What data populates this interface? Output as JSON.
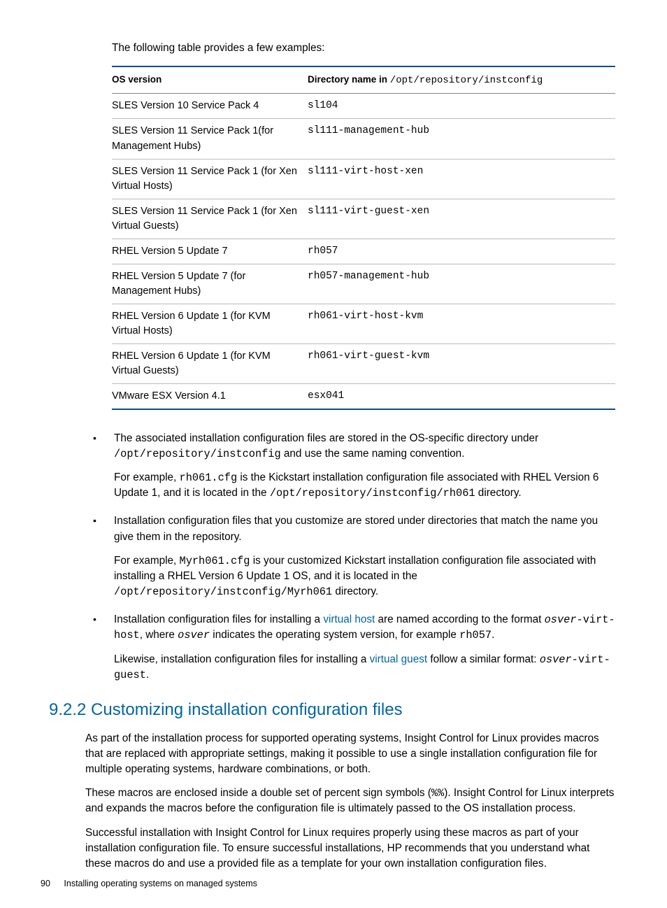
{
  "intro": "The following table provides a few examples:",
  "table": {
    "headers": {
      "os": "OS version",
      "dir_prefix": "Directory name in ",
      "dir_path": "/opt/repository/instconfig"
    },
    "rows": [
      {
        "os": "SLES Version 10 Service Pack 4",
        "dir": "sl104"
      },
      {
        "os": "SLES Version 11 Service Pack 1(for Management Hubs)",
        "dir": "sl111-management-hub"
      },
      {
        "os": "SLES Version 11 Service Pack 1 (for Xen Virtual Hosts)",
        "dir": "sl111-virt-host-xen"
      },
      {
        "os": "SLES Version 11 Service Pack 1 (for Xen Virtual Guests)",
        "dir": "sl111-virt-guest-xen"
      },
      {
        "os": "RHEL Version 5 Update 7",
        "dir": "rh057"
      },
      {
        "os": "RHEL Version 5 Update 7 (for Management Hubs)",
        "dir": "rh057-management-hub"
      },
      {
        "os": "RHEL Version 6 Update 1 (for KVM Virtual Hosts)",
        "dir": "rh061-virt-host-kvm"
      },
      {
        "os": "RHEL Version 6 Update 1 (for KVM Virtual Guests)",
        "dir": "rh061-virt-guest-kvm"
      },
      {
        "os": "VMware ESX Version 4.1",
        "dir": "esx041"
      }
    ]
  },
  "bullets": [
    {
      "p1_a": "The associated installation configuration files are stored in the OS-specific directory under ",
      "p1_code": "/opt/repository/instconfig",
      "p1_b": " and use the same naming convention.",
      "p2_a": "For example, ",
      "p2_code1": "rh061.cfg",
      "p2_b": " is the Kickstart installation configuration file associated with RHEL Version 6 Update 1, and it is located in the ",
      "p2_code2": "/opt/repository/instconfig/rh061",
      "p2_c": " directory."
    },
    {
      "p1": "Installation configuration files that you customize are stored under directories that match the name you give them in the repository.",
      "p2_a": "For example, ",
      "p2_code1": "Myrh061.cfg",
      "p2_b": " is your customized Kickstart installation configuration file associated with installing a RHEL Version 6 Update 1 OS, and it is located in the ",
      "p2_code2": "/opt/repository/instconfig/Myrh061",
      "p2_c": " directory."
    },
    {
      "p1_a": "Installation configuration files for installing a ",
      "p1_link": "virtual host",
      "p1_b": " are named according to the format ",
      "p1_code_it": "osver",
      "p1_code_rest": "-virt-host",
      "p1_c": ", where ",
      "p1_it": "osver",
      "p1_d": " indicates the operating system version, for example ",
      "p1_code2": "rh057",
      "p1_e": ".",
      "p2_a": "Likewise, installation configuration files for installing a ",
      "p2_link": "virtual guest",
      "p2_b": " follow a similar format: ",
      "p2_code_it": "osver",
      "p2_code_rest": "-virt-guest",
      "p2_c": "."
    }
  ],
  "section": {
    "title": "9.2.2 Customizing installation configuration files",
    "p1": "As part of the installation process for supported operating systems, Insight Control for Linux provides macros that are replaced with appropriate settings, making it possible to use a single installation configuration file for multiple operating systems, hardware combinations, or both.",
    "p2_a": "These macros are enclosed inside a double set of percent sign symbols (",
    "p2_code": "%%",
    "p2_b": "). Insight Control for Linux interprets and expands the macros before the configuration file is ultimately passed to the OS installation process.",
    "p3": "Successful installation with Insight Control for Linux requires properly using these macros as part of your installation configuration file. To ensure successful installations, HP recommends that you understand what these macros do and use a provided file as a template for your own installation configuration files."
  },
  "footer": {
    "page": "90",
    "chapter": "Installing operating systems on managed systems"
  }
}
